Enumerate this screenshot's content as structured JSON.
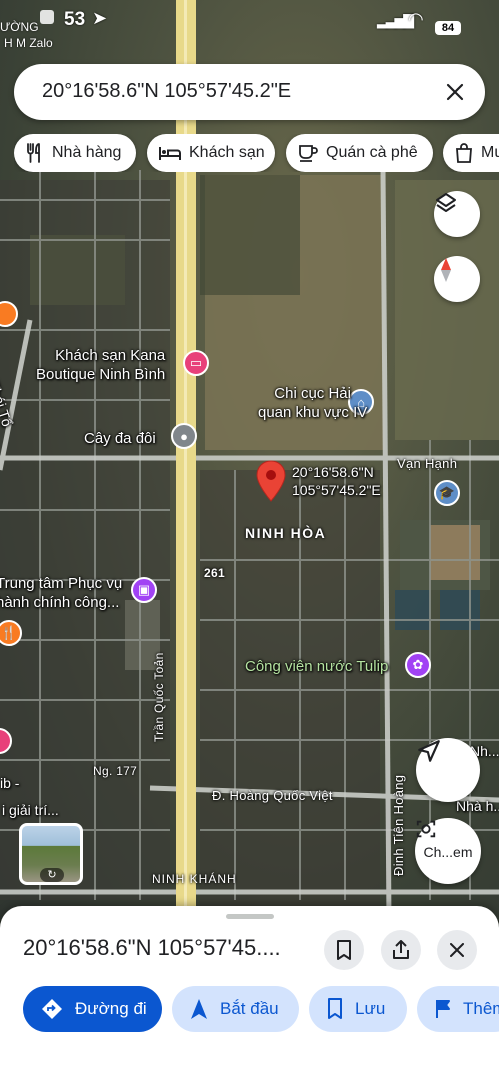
{
  "status": {
    "carrier_top": "ƯỜNG",
    "carrier_bottom": "H M Zalo",
    "time": "53",
    "battery": "84"
  },
  "search": {
    "value": "20°16'58.6\"N 105°57'45.2\"E",
    "close_icon": "close-icon"
  },
  "chips": [
    {
      "label": "Nhà hàng",
      "icon": "fork-knife-icon"
    },
    {
      "label": "Khách sạn",
      "icon": "bed-icon"
    },
    {
      "label": "Quán cà phê",
      "icon": "coffee-icon"
    },
    {
      "label": "Mu",
      "icon": "shopping-bag-icon"
    }
  ],
  "map": {
    "labels": {
      "hotel": "Khách sạn Kana\nBoutique Ninh Bình",
      "customs": "Chi cục Hải\nquan khu vực IV",
      "tree": "Cây đa đôi",
      "le_thai_to": "Lê Thái Tổ",
      "van_hanh": "Vạn Hạnh",
      "pin_coords": "20°16'58.6\"N\n105°57'45.2\"E",
      "ninh_hoa": "NINH HÒA",
      "road_261": "261",
      "service_center": "Trung tâm Phục vụ\nhành chính công...",
      "tulip": "Công viên nước Tulip",
      "tran_quoc_toan": "Trần Quốc Toản",
      "ng177": "Ng. 177",
      "hoang_quoc_viet": "Đ. Hoàng Quốc Việt",
      "ninh_khanh": "NINH KHÁNH",
      "dinh_tien_hoang": "Đinh Tiên Hoàng",
      "nha_right_1": "Nh...",
      "nha_right_2": "Nhà h...",
      "left_cut_1": "ib -",
      "left_cut_2": "i giải trí..."
    },
    "explore_label": "Ch...em",
    "colors": {
      "highway": "#e8d98a",
      "pin": "#ea4335",
      "poi_purple": "#a142f4",
      "poi_orange": "#f97b22",
      "poi_pink": "#e8407a",
      "poi_blue": "#5e8ec7"
    }
  },
  "sheet": {
    "title": "20°16'58.6\"N 105°57'45....",
    "actions": [
      {
        "label": "Đường đi",
        "icon": "directions-icon"
      },
      {
        "label": "Bắt đầu",
        "icon": "navigation-arrow-icon"
      },
      {
        "label": "Lưu",
        "icon": "bookmark-icon"
      },
      {
        "label": "Thêm",
        "icon": "flag-icon"
      }
    ]
  }
}
